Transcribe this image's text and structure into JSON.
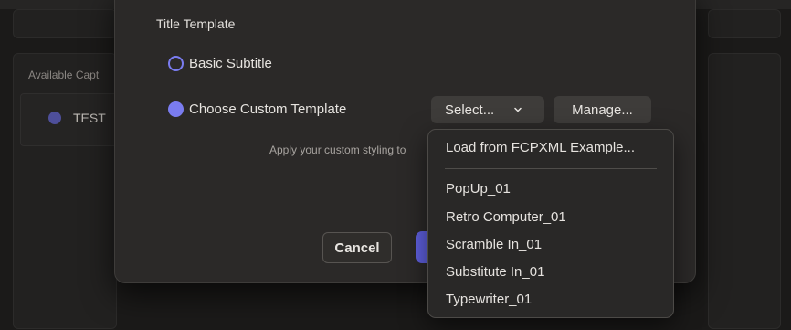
{
  "background": {
    "section_label": "Available Capt",
    "row_label": "TEST"
  },
  "dialog": {
    "section_title": "Title Template",
    "options": [
      {
        "label": "Basic Subtitle",
        "selected": false
      },
      {
        "label": "Choose Custom Template",
        "selected": true
      }
    ],
    "select_label": "Select...",
    "manage_label": "Manage...",
    "hint": "Apply your custom styling to",
    "cancel_label": "Cancel"
  },
  "menu": {
    "load_label": "Load from FCPXML Example...",
    "items": [
      "PopUp_01",
      "Retro Computer_01",
      "Scramble In_01",
      "Substitute In_01",
      "Typewriter_01"
    ]
  },
  "colors": {
    "accent": "#7a7cf0",
    "primary_button": "#5f60e0"
  },
  "icons": {
    "select_chevron": "chevron-down-icon"
  }
}
